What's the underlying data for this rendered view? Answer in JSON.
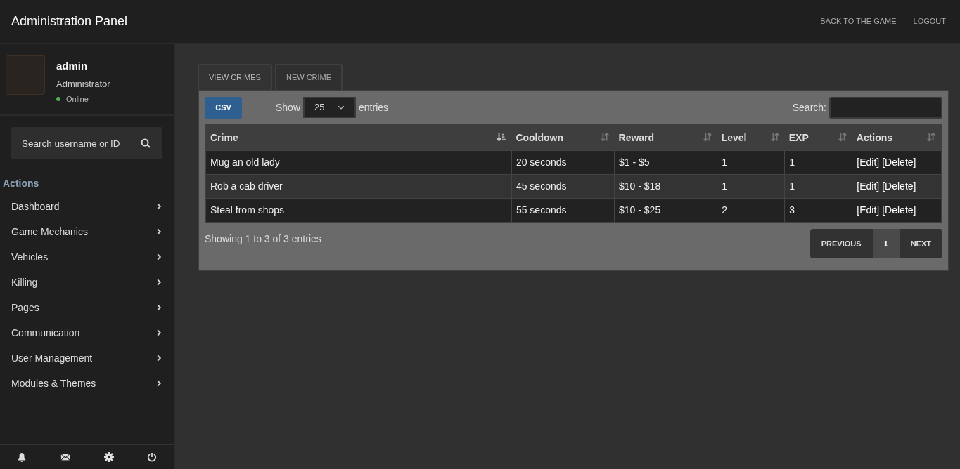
{
  "header": {
    "title": "Administration Panel",
    "links": [
      "BACK TO THE GAME",
      "LOGOUT"
    ]
  },
  "profile": {
    "username": "admin",
    "role": "Administrator",
    "status": "Online",
    "online": true
  },
  "sidebar": {
    "search": {
      "placeholder": "Search username or ID"
    },
    "section": "Actions",
    "items": [
      {
        "label": "Dashboard"
      },
      {
        "label": "Game Mechanics"
      },
      {
        "label": "Vehicles"
      },
      {
        "label": "Killing"
      },
      {
        "label": "Pages"
      },
      {
        "label": "Communication"
      },
      {
        "label": "User Management"
      },
      {
        "label": "Modules & Themes"
      }
    ]
  },
  "tabs": [
    {
      "label": "VIEW CRIMES",
      "selected": true
    },
    {
      "label": "NEW CRIME",
      "selected": false
    }
  ],
  "toolbar": {
    "csv": "CSV",
    "show": "Show",
    "length": "25",
    "entries": "entries",
    "search_label": "Search:"
  },
  "table": {
    "columns": [
      {
        "label": "Crime",
        "sorted": true
      },
      {
        "label": "Cooldown",
        "sorted": false
      },
      {
        "label": "Reward",
        "sorted": false
      },
      {
        "label": "Level",
        "sorted": false
      },
      {
        "label": "EXP",
        "sorted": false
      },
      {
        "label": "Actions",
        "sorted": false
      }
    ],
    "rows": [
      {
        "cells": [
          "Mug an old lady",
          "20 seconds",
          "$1 - $5",
          "1",
          "1"
        ],
        "actions": [
          "[Edit]",
          "[Delete]"
        ]
      },
      {
        "cells": [
          "Rob a cab driver",
          "45 seconds",
          "$10 - $18",
          "1",
          "1"
        ],
        "actions": [
          "[Edit]",
          "[Delete]"
        ]
      },
      {
        "cells": [
          "Steal from shops",
          "55 seconds",
          "$10 - $25",
          "2",
          "3"
        ],
        "actions": [
          "[Edit]",
          "[Delete]"
        ]
      }
    ]
  },
  "info": "Showing 1 to 3 of 3 entries",
  "pagination": [
    {
      "label": "PREVIOUS",
      "selected": false
    },
    {
      "label": "1",
      "selected": true
    },
    {
      "label": "NEXT",
      "selected": false
    }
  ]
}
